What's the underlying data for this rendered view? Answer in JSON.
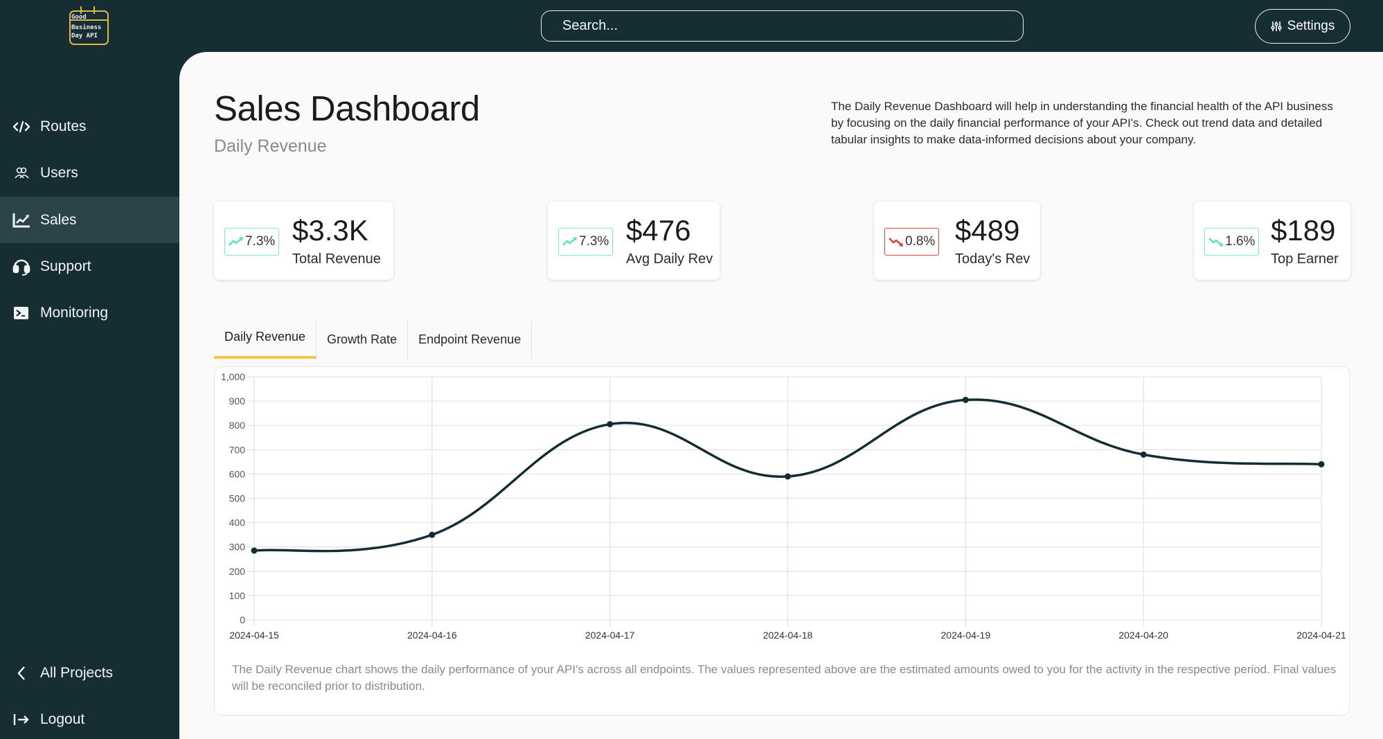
{
  "app": {
    "logo_lines": [
      "Good",
      "Business",
      "Day API"
    ],
    "logo_color": "#e0b84a"
  },
  "topbar": {
    "search_placeholder": "Search...",
    "settings_label": "Settings",
    "settings_icon": "sliders-icon"
  },
  "sidebar": {
    "items": [
      {
        "label": "Routes",
        "icon": "code-icon",
        "active": false
      },
      {
        "label": "Users",
        "icon": "users-icon",
        "active": false
      },
      {
        "label": "Sales",
        "icon": "chart-line-icon",
        "active": true
      },
      {
        "label": "Support",
        "icon": "headset-icon",
        "active": false
      },
      {
        "label": "Monitoring",
        "icon": "terminal-icon",
        "active": false
      }
    ],
    "bottom_items": [
      {
        "label": "All Projects",
        "icon": "chevron-left-icon"
      },
      {
        "label": "Logout",
        "icon": "logout-icon"
      }
    ]
  },
  "header": {
    "title": "Sales Dashboard",
    "subtitle": "Daily Revenue",
    "description": "The Daily Revenue Dashboard will help in understanding the financial health of the API business by focusing on the daily financial performance of your API's. Check out trend data and detailed tabular insights to make data-informed decisions about your company."
  },
  "stats": [
    {
      "change": "7.3%",
      "direction": "up",
      "value": "$3.3K",
      "label": "Total Revenue",
      "badge_color": "#7ee8cf"
    },
    {
      "change": "7.3%",
      "direction": "up",
      "value": "$476",
      "label": "Avg Daily Rev",
      "badge_color": "#7ee8cf"
    },
    {
      "change": "0.8%",
      "direction": "down",
      "value": "$489",
      "label": "Today's Rev",
      "badge_color": "#d94040"
    },
    {
      "change": "1.6%",
      "direction": "down",
      "value": "$189",
      "label": "Top Earner",
      "badge_color": "#7ee8cf"
    }
  ],
  "tabs": [
    {
      "label": "Daily Revenue",
      "active": true
    },
    {
      "label": "Growth Rate",
      "active": false
    },
    {
      "label": "Endpoint Revenue",
      "active": false
    }
  ],
  "colors": {
    "sidebar_bg": "#162d34",
    "accent_tab": "#f6c343",
    "line": "#142c33",
    "up": "#5fe0c0",
    "down": "#d94040"
  },
  "chart_data": {
    "type": "line",
    "title": "",
    "xlabel": "",
    "ylabel": "",
    "x": [
      "2024-04-15",
      "2024-04-16",
      "2024-04-17",
      "2024-04-18",
      "2024-04-19",
      "2024-04-20",
      "2024-04-21"
    ],
    "series": [
      {
        "name": "Daily Revenue",
        "values": [
          285,
          350,
          805,
          590,
          905,
          680,
          640
        ]
      }
    ],
    "ylim": [
      0,
      1000
    ],
    "yticks": [
      0,
      100,
      200,
      300,
      400,
      500,
      600,
      700,
      800,
      900,
      1000
    ],
    "ytick_labels": [
      "0",
      "100",
      "200",
      "300",
      "400",
      "500",
      "600",
      "700",
      "800",
      "900",
      "1,000"
    ],
    "grid": true,
    "legend": "none",
    "smooth": true
  },
  "caption": "The Daily Revenue chart shows the daily performance of your API's across all endpoints. The values represented above are the estimated amounts owed to you for the activity in the respective period. Final values will be reconciled prior to distribution."
}
